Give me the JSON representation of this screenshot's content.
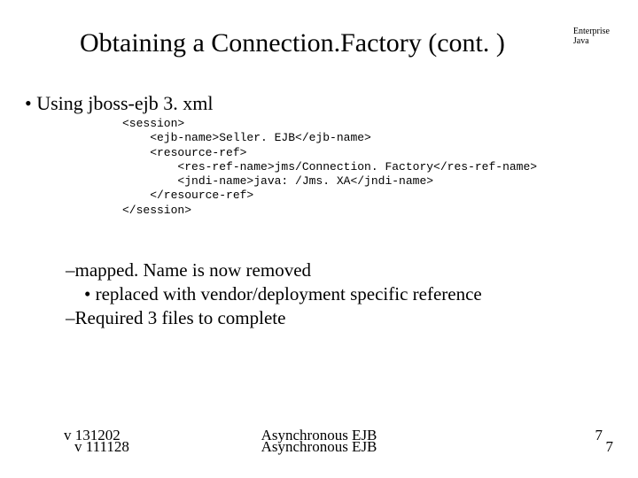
{
  "title": "Obtaining a Connection.Factory (cont. )",
  "corner": {
    "line1": "Enterprise",
    "line2": "Java"
  },
  "bullet_main": "• Using jboss-ejb 3. xml",
  "code": "<session>\n    <ejb-name>Seller. EJB</ejb-name>\n    <resource-ref>\n        <res-ref-name>jms/Connection. Factory</res-ref-name>\n        <jndi-name>java: /Jms. XA</jndi-name>\n    </resource-ref>\n</session>",
  "notes": {
    "line1": "–mapped. Name is now removed",
    "line2": "    • replaced with vendor/deployment specific reference",
    "line3": "–Required 3 files to complete"
  },
  "footer": {
    "left1": "v 131202",
    "left2": "v 111128",
    "center1": "Asynchronous EJB",
    "center2": "Asynchronous EJB",
    "right1": "7",
    "right2": "7"
  }
}
